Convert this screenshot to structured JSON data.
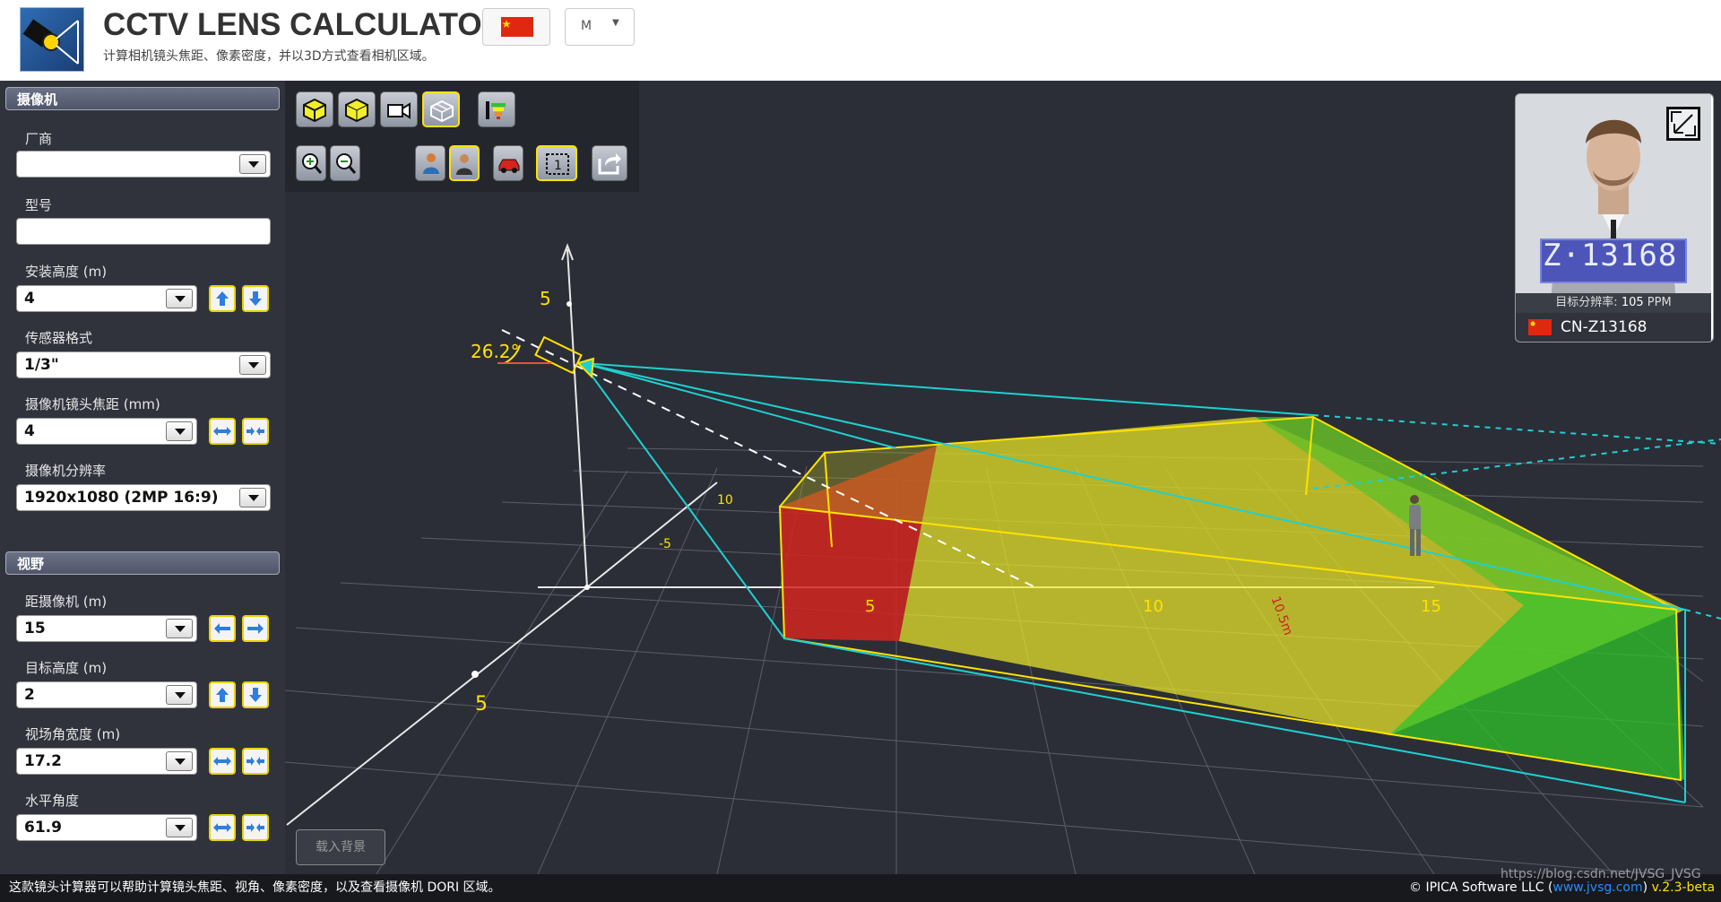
{
  "app": {
    "title": "CCTV LENS CALCULATOR",
    "subtitle": "计算相机镜头焦距、像素密度，并以3D方式查看相机区域。",
    "unit": "M"
  },
  "camera": {
    "section_title": "摄像机",
    "manufacturer_label": "厂商",
    "manufacturer_value": "",
    "model_label": "型号",
    "model_value": "",
    "install_height_label": "安装高度 (m)",
    "install_height_value": "4",
    "sensor_format_label": "传感器格式",
    "sensor_format_value": "1/3\"",
    "focal_length_label": "摄像机镜头焦距 (mm)",
    "focal_length_value": "4",
    "resolution_label": "摄像机分辨率",
    "resolution_value": "1920x1080 (2MP 16:9)"
  },
  "view": {
    "section_title": "视野",
    "distance_label": "距摄像机 (m)",
    "distance_value": "15",
    "target_height_label": "目标高度 (m)",
    "target_height_value": "2",
    "fov_width_label": "视场角宽度 (m)",
    "fov_width_value": "17.2",
    "h_angle_label": "水平角度",
    "h_angle_value": "61.9"
  },
  "scene": {
    "angle_label": "26.2°",
    "axis_labels": [
      "5",
      "10",
      "-5",
      "5",
      "10",
      "15",
      "5"
    ],
    "dist_marker": "10.5m",
    "colors": {
      "red": "#d3261f",
      "yellow": "#f2ee2a",
      "green": "#2fc42a",
      "cyan": "#1fd0d0",
      "accent": "#ffe200"
    }
  },
  "preview": {
    "ppm_label": "目标分辨率:",
    "ppm_value": "105",
    "ppm_unit": "PPM",
    "plate": "CN-Z13168",
    "plate_overlay": "Z·13168"
  },
  "load_background": "载入背景",
  "footer": {
    "description": "这款镜头计算器可以帮助计算镜头焦距、视角、像素密度，以及查看摄像机 DORI 区域。",
    "copyright": "© IPICA Software LLC (",
    "link": "www.jvsg.com",
    "close": ")",
    "version": "v.2.3-beta",
    "watermark": "https://blog.csdn.net/JVSG_JVSG"
  },
  "icons": [
    "cube-solid-icon",
    "cube-icon",
    "video-camera-icon",
    "cube-outline-icon",
    "dori-bars-icon",
    "zoom-in-icon",
    "zoom-out-icon",
    "person-icon",
    "person-face-icon",
    "car-icon",
    "grid-one-icon",
    "share-icon",
    "expand-icon"
  ]
}
